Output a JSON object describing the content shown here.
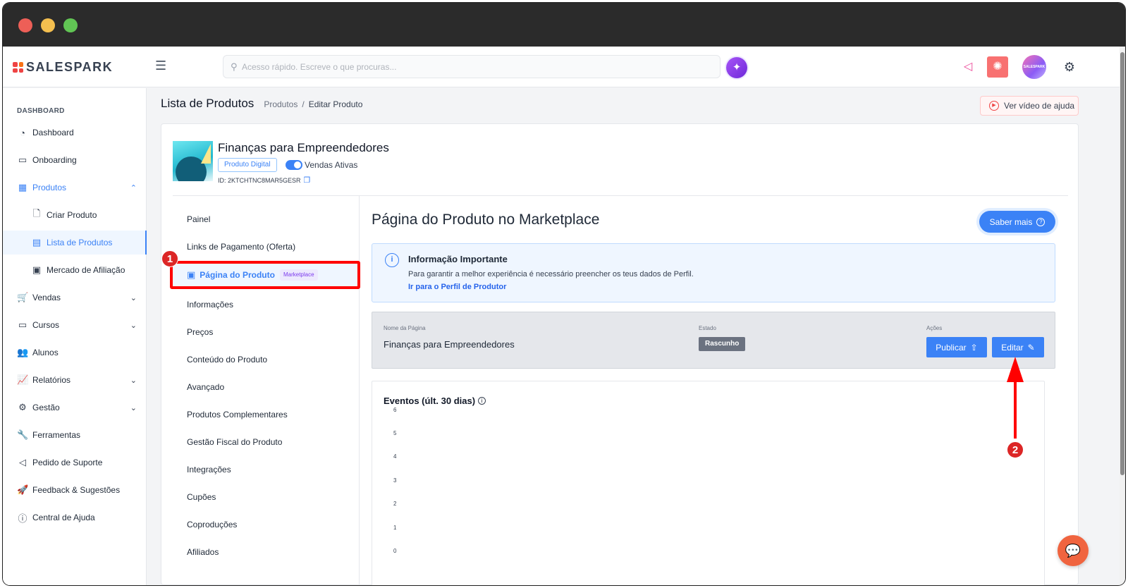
{
  "app": {
    "logo_text": "SALESPARK",
    "search_placeholder": "Acesso rápido. Escreve o que procuras...",
    "avatar_text": "SALESPARK",
    "brand_color": "#3b82f6"
  },
  "sidebar": {
    "section": "DASHBOARD",
    "items": [
      {
        "label": "Dashboard",
        "icon": "gauge-icon"
      },
      {
        "label": "Onboarding",
        "icon": "video-icon"
      },
      {
        "label": "Produtos",
        "icon": "grid-icon"
      },
      {
        "label": "Criar Produto",
        "icon": "file-plus-icon"
      },
      {
        "label": "Lista de Produtos",
        "icon": "table-icon"
      },
      {
        "label": "Mercado de Afiliação",
        "icon": "store-icon"
      },
      {
        "label": "Vendas",
        "icon": "cart-icon"
      },
      {
        "label": "Cursos",
        "icon": "monitor-icon"
      },
      {
        "label": "Alunos",
        "icon": "users-icon"
      },
      {
        "label": "Relatórios",
        "icon": "chart-line-icon"
      },
      {
        "label": "Gestão",
        "icon": "gear-icon"
      },
      {
        "label": "Ferramentas",
        "icon": "wrench-icon"
      },
      {
        "label": "Pedido de Suporte",
        "icon": "megaphone-icon"
      },
      {
        "label": "Feedback & Sugestões",
        "icon": "rocket-icon"
      },
      {
        "label": "Central de Ajuda",
        "icon": "help-circle-icon"
      }
    ]
  },
  "header": {
    "title": "Lista de Produtos",
    "breadcrumb": [
      "Produtos",
      "Editar Produto"
    ],
    "breadcrumb_sep": "/",
    "help_button": "Ver vídeo de ajuda"
  },
  "product": {
    "name": "Finanças para Empreendedores",
    "type_badge": "Produto Digital",
    "sales_toggle_label": "Vendas Ativas",
    "sales_active": true,
    "id_label": "ID: 2KTCHTNC8MAR5GESR"
  },
  "subnav": {
    "items": [
      "Painel",
      "Links de Pagamento (Oferta)",
      "Página do Produto",
      "Informações",
      "Preços",
      "Conteúdo do Produto",
      "Avançado",
      "Produtos Complementares",
      "Gestão Fiscal do Produto",
      "Integrações",
      "Cupões",
      "Coproduções",
      "Afiliados"
    ],
    "active_tag": "Marketplace"
  },
  "content": {
    "title": "Página do Produto no Marketplace",
    "saber_mais": "Saber mais",
    "info": {
      "title": "Informação Importante",
      "text": "Para garantir a melhor experiência é necessário preencher os teus dados de Perfil.",
      "link": "Ir para o Perfil de Produtor"
    },
    "page_table": {
      "col_name": "Nome da Página",
      "col_state": "Estado",
      "col_actions": "Ações",
      "name": "Finanças para Empreendedores",
      "state": "Rascunho",
      "publish": "Publicar",
      "edit": "Editar"
    },
    "events": {
      "title": "Eventos (últ. 30 dias)",
      "yticks": [
        "6",
        "5",
        "4",
        "3",
        "2",
        "1",
        "0"
      ]
    }
  },
  "annotations": {
    "marker1": "1",
    "marker2": "2",
    "color": "#ff0000"
  }
}
